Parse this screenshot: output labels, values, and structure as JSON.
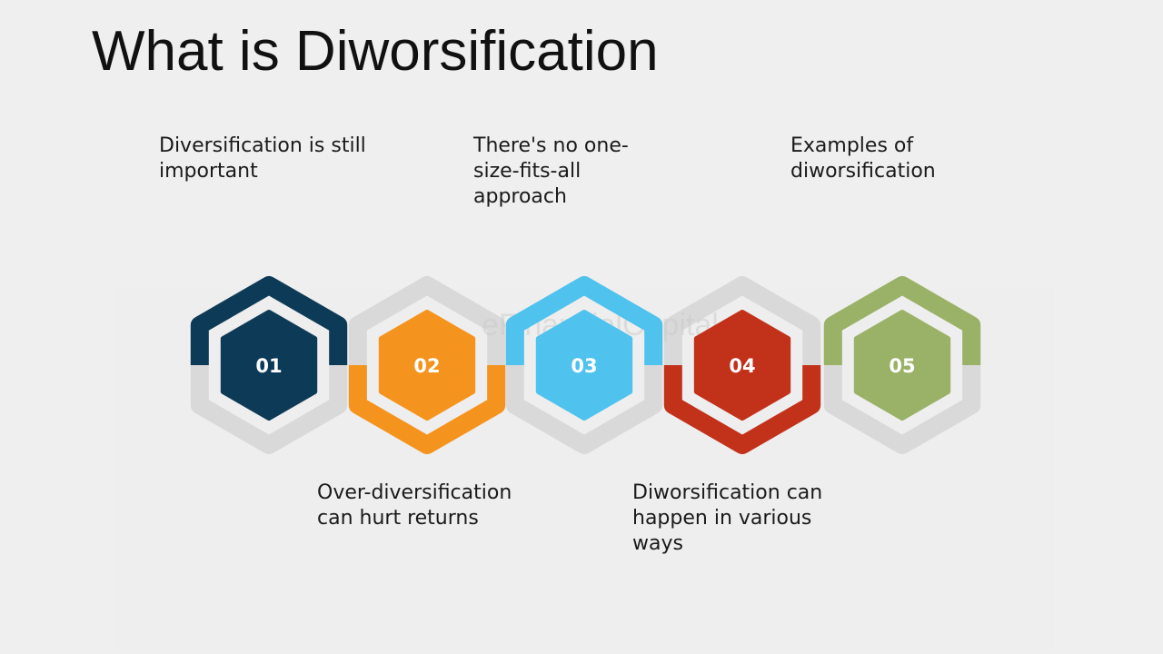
{
  "title": "What is Diworsification",
  "colors": {
    "background": "#f0eff0",
    "ring_gray": "#d9d9d9",
    "step_01": "#0c3a57",
    "step_02": "#f4941e",
    "step_03": "#4fc2ee",
    "step_04": "#c2311a",
    "step_05": "#9ab267"
  },
  "steps": [
    {
      "number": "01",
      "label": "Diversification is still important",
      "position": "top",
      "color": "#0c3a57",
      "half": "top"
    },
    {
      "number": "02",
      "label": "Over-diversification can hurt returns",
      "position": "bottom",
      "color": "#f4941e",
      "half": "bottom"
    },
    {
      "number": "03",
      "label": "There's no one-size-fits-all approach",
      "position": "top",
      "color": "#4fc2ee",
      "half": "top"
    },
    {
      "number": "04",
      "label": "Diworsification can happen in various ways",
      "position": "bottom",
      "color": "#c2311a",
      "half": "bottom"
    },
    {
      "number": "05",
      "label": "Examples of diworsification",
      "position": "top",
      "color": "#9ab267",
      "half": "top"
    }
  ],
  "watermark": "eFinancialCapital"
}
